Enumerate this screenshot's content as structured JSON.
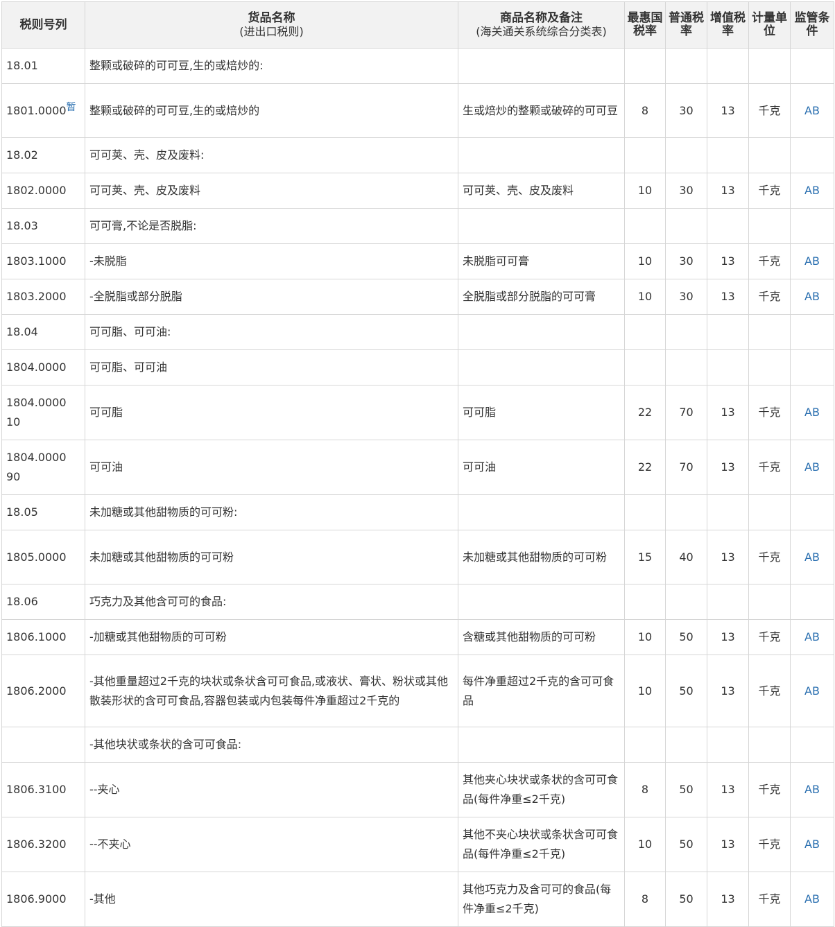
{
  "headers": [
    {
      "title": "税则号列",
      "sub": ""
    },
    {
      "title": "货品名称",
      "sub": "(进出口税则)"
    },
    {
      "title": "商品名称及备注",
      "sub": "(海关通关系统综合分类表)"
    },
    {
      "title": "最惠国税率",
      "sub": ""
    },
    {
      "title": "普通税率",
      "sub": ""
    },
    {
      "title": "增值税率",
      "sub": ""
    },
    {
      "title": "计量单位",
      "sub": ""
    },
    {
      "title": "监管条件",
      "sub": ""
    }
  ],
  "temp_mark": "暂",
  "rows": [
    {
      "code": "18.01",
      "name": "整颗或破碎的可可豆,生的或焙炒的:",
      "note": "",
      "mfn": "",
      "general": "",
      "vat": "",
      "unit": "",
      "cond": ""
    },
    {
      "code": "1801.0000",
      "name": "整颗或破碎的可可豆,生的或焙炒的",
      "note": "生或焙炒的整颗或破碎的可可豆",
      "mfn": "8",
      "general": "30",
      "vat": "13",
      "unit": "千克",
      "cond": "AB"
    },
    {
      "code": "18.02",
      "name": "可可荚、壳、皮及废料:",
      "note": "",
      "mfn": "",
      "general": "",
      "vat": "",
      "unit": "",
      "cond": ""
    },
    {
      "code": "1802.0000",
      "name": "可可荚、壳、皮及废料",
      "note": "可可荚、壳、皮及废料",
      "mfn": "10",
      "general": "30",
      "vat": "13",
      "unit": "千克",
      "cond": "AB"
    },
    {
      "code": "18.03",
      "name": "可可膏,不论是否脱脂:",
      "note": "",
      "mfn": "",
      "general": "",
      "vat": "",
      "unit": "",
      "cond": ""
    },
    {
      "code": "1803.1000",
      "name": "-未脱脂",
      "note": "未脱脂可可膏",
      "mfn": "10",
      "general": "30",
      "vat": "13",
      "unit": "千克",
      "cond": "AB"
    },
    {
      "code": "1803.2000",
      "name": "-全脱脂或部分脱脂",
      "note": "全脱脂或部分脱脂的可可膏",
      "mfn": "10",
      "general": "30",
      "vat": "13",
      "unit": "千克",
      "cond": "AB"
    },
    {
      "code": "18.04",
      "name": "可可脂、可可油:",
      "note": "",
      "mfn": "",
      "general": "",
      "vat": "",
      "unit": "",
      "cond": ""
    },
    {
      "code": "1804.0000",
      "name": "可可脂、可可油",
      "note": "",
      "mfn": "",
      "general": "",
      "vat": "",
      "unit": "",
      "cond": ""
    },
    {
      "code": "1804.0000 10",
      "name": "可可脂",
      "note": "可可脂",
      "mfn": "22",
      "general": "70",
      "vat": "13",
      "unit": "千克",
      "cond": "AB"
    },
    {
      "code": "1804.0000 90",
      "name": "可可油",
      "note": "可可油",
      "mfn": "22",
      "general": "70",
      "vat": "13",
      "unit": "千克",
      "cond": "AB"
    },
    {
      "code": "18.05",
      "name": "未加糖或其他甜物质的可可粉:",
      "note": "",
      "mfn": "",
      "general": "",
      "vat": "",
      "unit": "",
      "cond": ""
    },
    {
      "code": "1805.0000",
      "name": "未加糖或其他甜物质的可可粉",
      "note": "未加糖或其他甜物质的可可粉",
      "mfn": "15",
      "general": "40",
      "vat": "13",
      "unit": "千克",
      "cond": "AB"
    },
    {
      "code": "18.06",
      "name": "巧克力及其他含可可的食品:",
      "note": "",
      "mfn": "",
      "general": "",
      "vat": "",
      "unit": "",
      "cond": ""
    },
    {
      "code": "1806.1000",
      "name": "-加糖或其他甜物质的可可粉",
      "note": "含糖或其他甜物质的可可粉",
      "mfn": "10",
      "general": "50",
      "vat": "13",
      "unit": "千克",
      "cond": "AB"
    },
    {
      "code": "1806.2000",
      "name": "-其他重量超过2千克的块状或条状含可可食品,或液状、膏状、粉状或其他散装形状的含可可食品,容器包装或内包装每件净重超过2千克的",
      "note": "每件净重超过2千克的含可可食品",
      "mfn": "10",
      "general": "50",
      "vat": "13",
      "unit": "千克",
      "cond": "AB"
    },
    {
      "code": "",
      "name": "-其他块状或条状的含可可食品:",
      "note": "",
      "mfn": "",
      "general": "",
      "vat": "",
      "unit": "",
      "cond": ""
    },
    {
      "code": "1806.3100",
      "name": "--夹心",
      "note": "其他夹心块状或条状的含可可食品(每件净重≤2千克)",
      "mfn": "8",
      "general": "50",
      "vat": "13",
      "unit": "千克",
      "cond": "AB"
    },
    {
      "code": "1806.3200",
      "name": "--不夹心",
      "note": "其他不夹心块状或条状含可可食品(每件净重≤2千克)",
      "mfn": "10",
      "general": "50",
      "vat": "13",
      "unit": "千克",
      "cond": "AB"
    },
    {
      "code": "1806.9000",
      "name": "-其他",
      "note": "其他巧克力及含可可的食品(每件净重≤2千克)",
      "mfn": "8",
      "general": "50",
      "vat": "13",
      "unit": "千克",
      "cond": "AB"
    }
  ]
}
